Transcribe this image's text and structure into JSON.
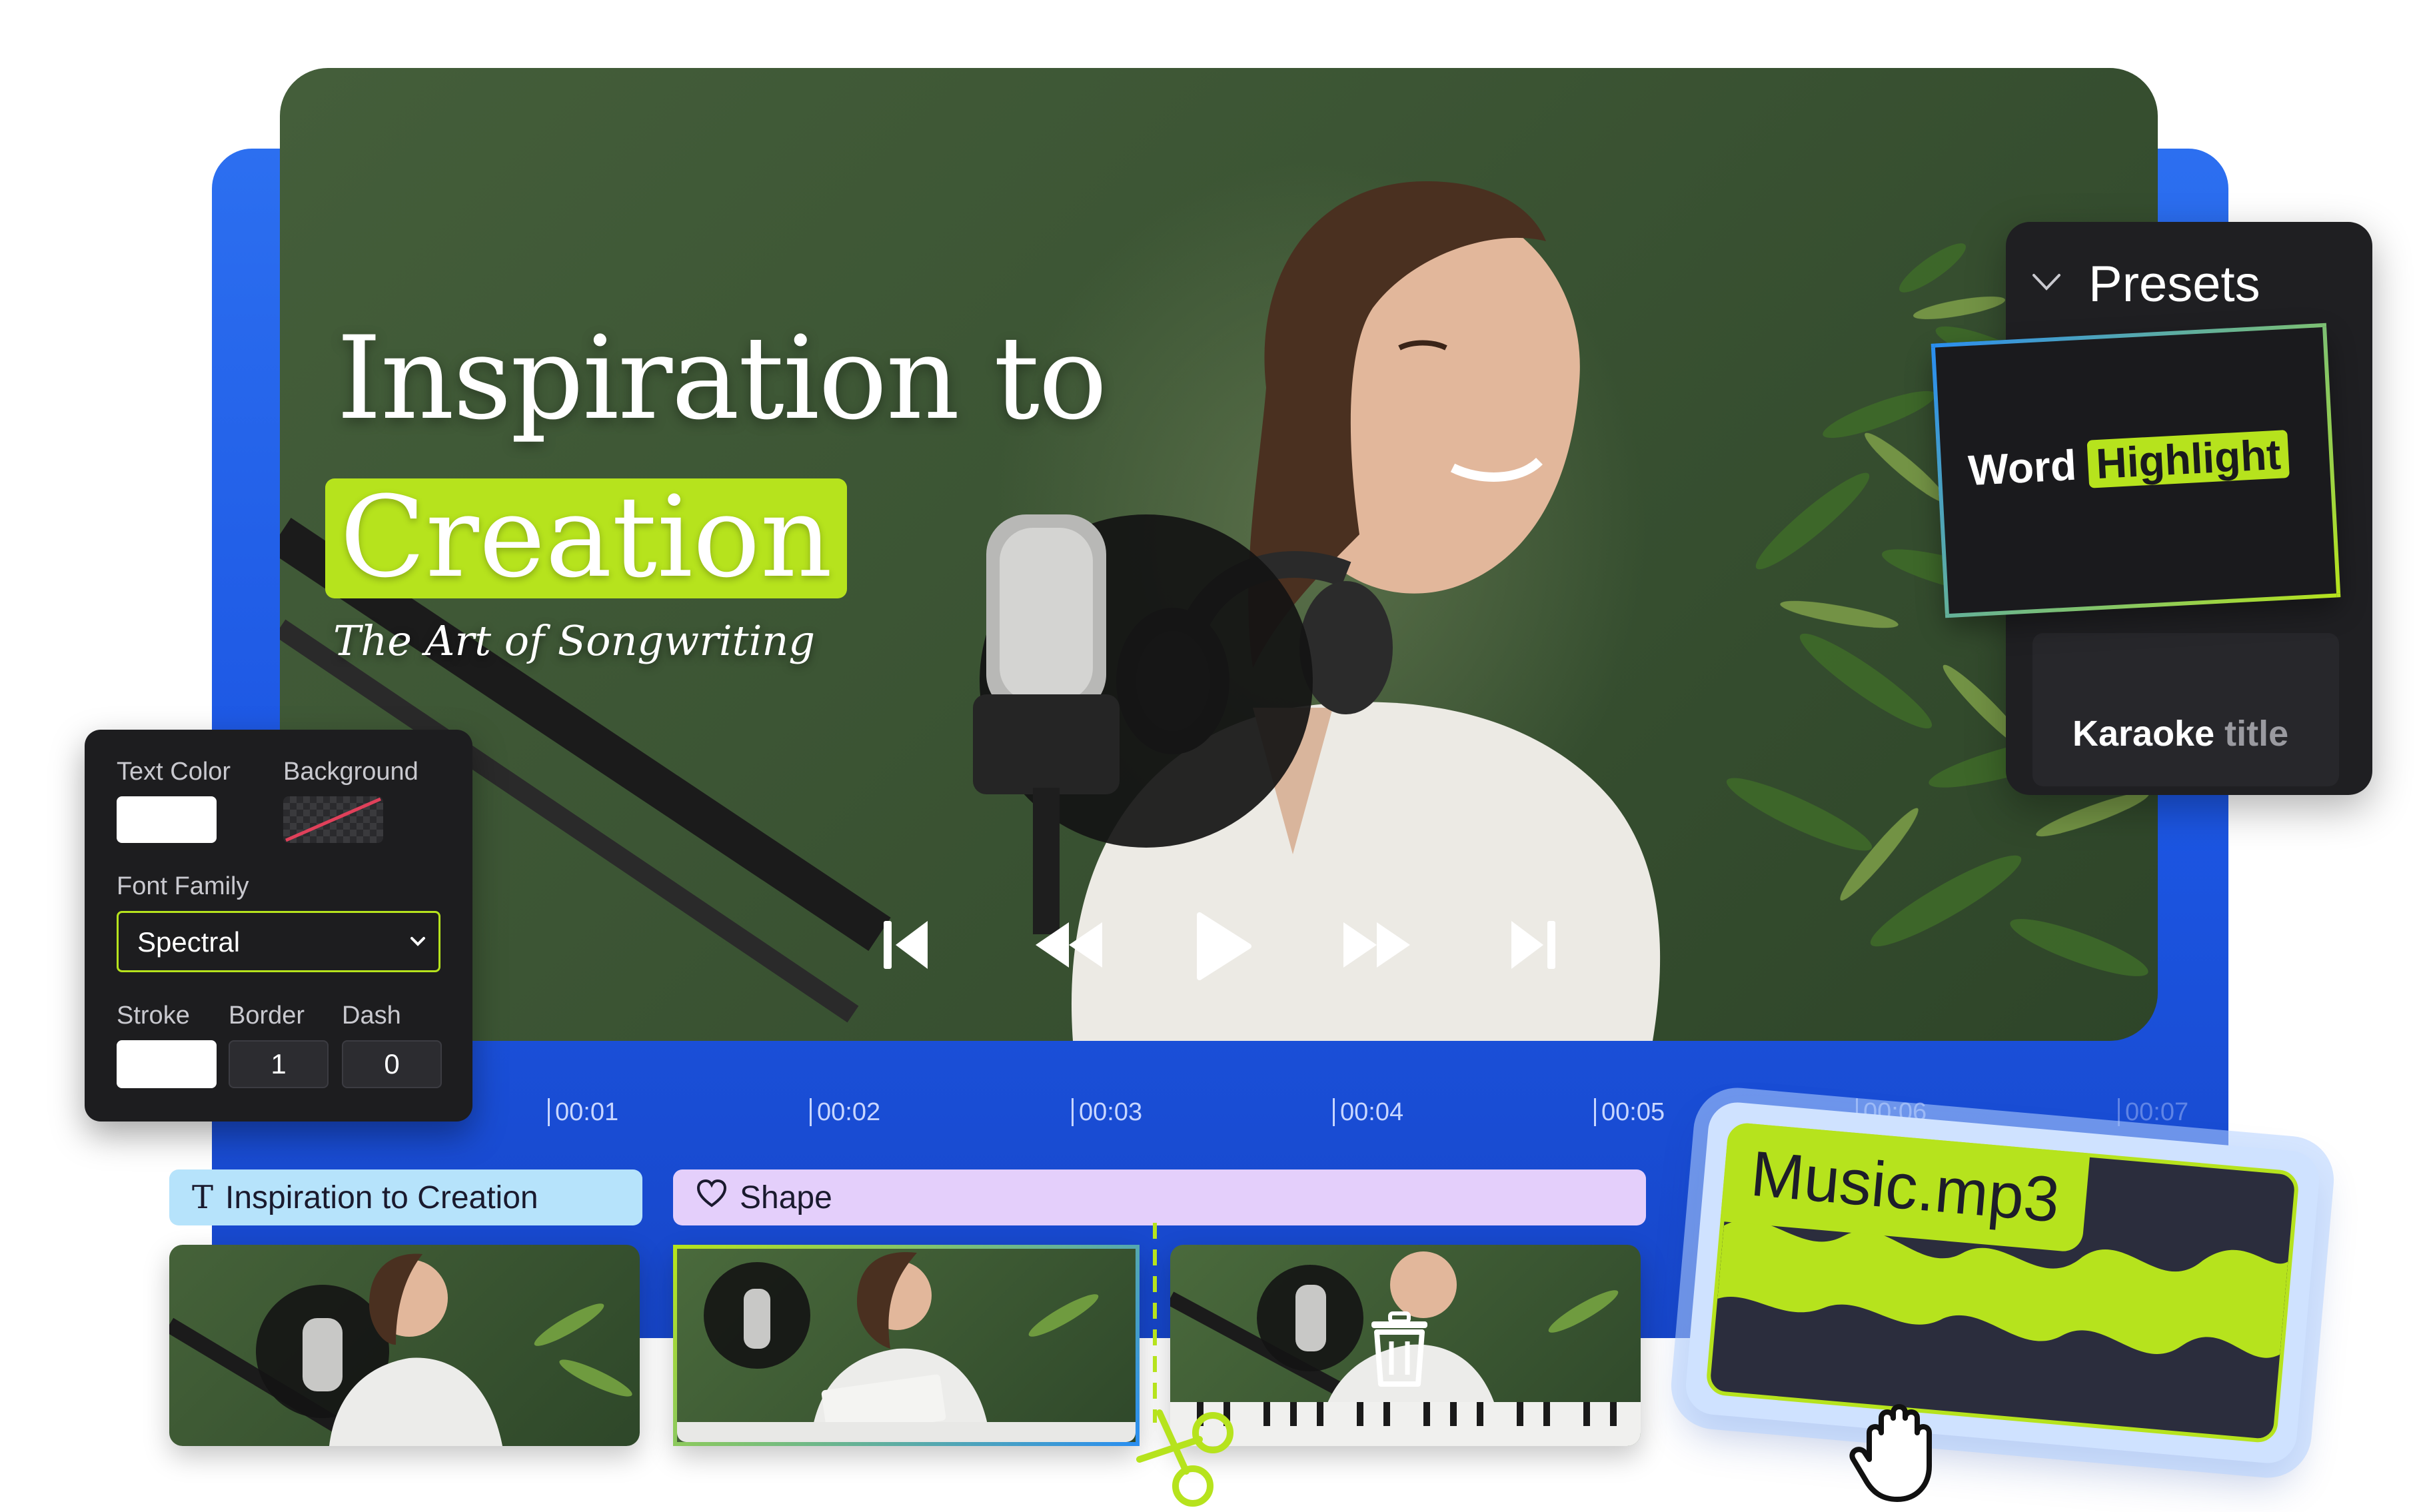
{
  "video": {
    "title_line1": "Inspiration to",
    "title_highlight": "Creation",
    "subtitle": "The Art of Songwriting"
  },
  "playback": {
    "controls": [
      "skip-back",
      "rewind",
      "play",
      "fast-forward",
      "skip-forward"
    ]
  },
  "timeline": {
    "ticks": [
      "00:01",
      "00:02",
      "00:03",
      "00:04",
      "00:05",
      "00:06",
      "00:07"
    ]
  },
  "properties": {
    "text_color_label": "Text Color",
    "background_label": "Background",
    "font_family_label": "Font Family",
    "font_family_value": "Spectral",
    "stroke_label": "Stroke",
    "border_label": "Border",
    "border_value": "1",
    "dash_label": "Dash",
    "dash_value": "0",
    "colors": {
      "text_color": "#ffffff",
      "stroke_color": "#ffffff",
      "accent": "#b6e31d"
    }
  },
  "presets": {
    "title": "Presets",
    "word_highlight": {
      "word": "Word",
      "highlight": "Highlight"
    },
    "karaoke": {
      "word": "Karaoke",
      "rest": "title"
    }
  },
  "tracks": {
    "text_track": "Inspiration to Creation",
    "shape_track": "Shape",
    "audio_file": "Music.mp3"
  },
  "icons": {
    "text_track": "text-icon",
    "shape_track": "heart-icon",
    "delete": "trash-icon",
    "cut": "scissors-icon",
    "cursor": "hand-cursor-icon",
    "dropdown": "chevron-down-icon"
  },
  "colors": {
    "brand_blue": "#1f5ce8",
    "accent_green": "#b6e31d",
    "text_track": "#b6e3fb",
    "shape_track": "#e4cffb"
  }
}
